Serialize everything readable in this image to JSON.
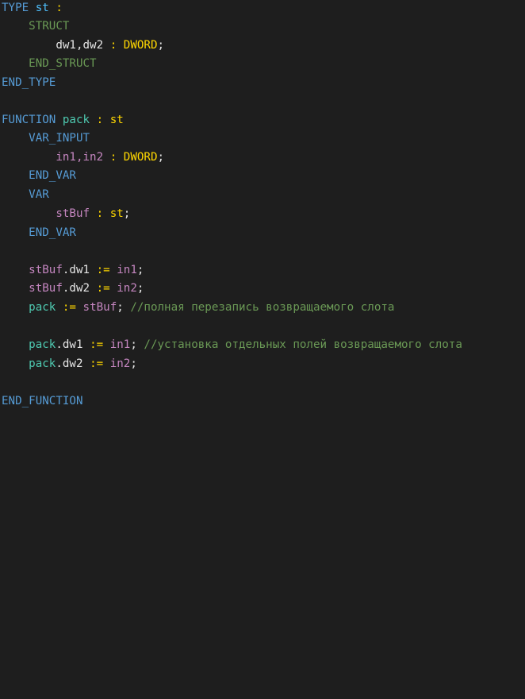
{
  "code": {
    "l1": {
      "kw": "TYPE",
      "name": "st",
      "colon": ":"
    },
    "l2": {
      "kw": "STRUCT"
    },
    "l3": {
      "vars": "dw1,dw2",
      "colon": ":",
      "type": "DWORD",
      "semi": ";"
    },
    "l4": {
      "kw": "END_STRUCT"
    },
    "l5": {
      "kw": "END_TYPE"
    },
    "l7": {
      "kw": "FUNCTION",
      "name": "pack",
      "colon": ":",
      "type": "st"
    },
    "l8": {
      "kw": "VAR_INPUT"
    },
    "l9": {
      "vars": "in1,in2",
      "colon": ":",
      "type": "DWORD",
      "semi": ";"
    },
    "l10": {
      "kw": "END_VAR"
    },
    "l11": {
      "kw": "VAR"
    },
    "l12": {
      "vars": "stBuf",
      "colon": ":",
      "type": "st",
      "semi": ";"
    },
    "l13": {
      "kw": "END_VAR"
    },
    "l15": {
      "lhs": "stBuf.dw1",
      "op": ":=",
      "rhs": "in1",
      "semi": ";"
    },
    "l16": {
      "lhs": "stBuf.dw2",
      "op": ":=",
      "rhs": "in2",
      "semi": ";"
    },
    "l17": {
      "lhs": "pack",
      "op": ":=",
      "rhs": "stBuf",
      "semi": ";",
      "comment": "//полная перезапись возвращаемого слота"
    },
    "l19": {
      "lhs": "pack.dw1",
      "op": ":=",
      "rhs": "in1",
      "semi": ";",
      "comment": "//установка отдельных полей возвращаемого слота"
    },
    "l20": {
      "lhs": "pack.dw2",
      "op": ":=",
      "rhs": "in2",
      "semi": ";"
    },
    "l22": {
      "kw": "END_FUNCTION"
    }
  },
  "colors": {
    "background": "#1e1e1e",
    "keyword": "#569cd6",
    "struct_keyword": "#6a9955",
    "type": "#dcdcaa",
    "identifier": "#9cdcfe",
    "comment": "#6a9955"
  }
}
